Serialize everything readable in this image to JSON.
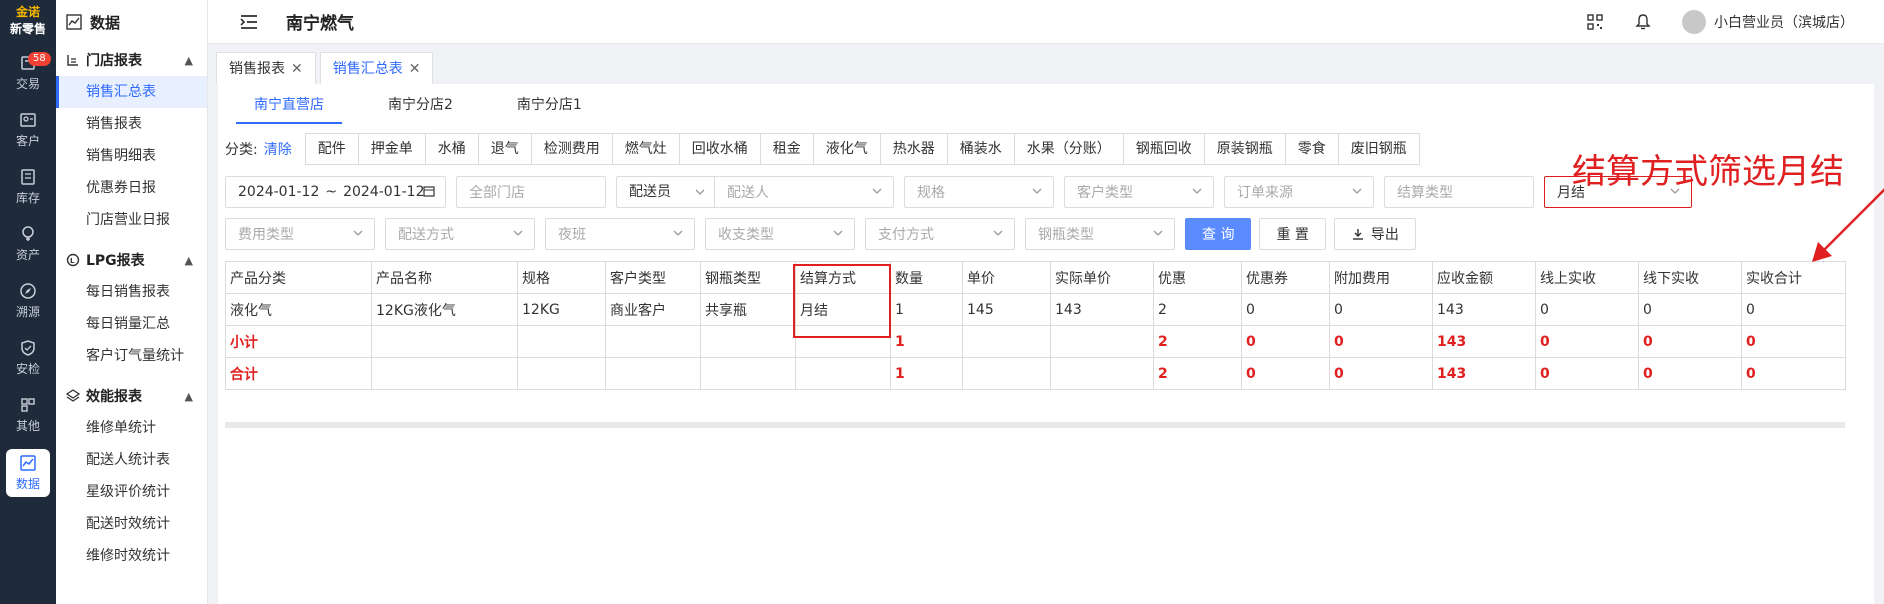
{
  "brand": {
    "logo_line1": "金诺",
    "logo_line2": "新零售"
  },
  "rail": [
    {
      "label": "交易",
      "icon": "trade-icon",
      "badge": "58"
    },
    {
      "label": "客户",
      "icon": "customer-icon"
    },
    {
      "label": "库存",
      "icon": "inventory-icon"
    },
    {
      "label": "资产",
      "icon": "asset-icon"
    },
    {
      "label": "溯源",
      "icon": "trace-icon"
    },
    {
      "label": "安检",
      "icon": "safety-icon"
    },
    {
      "label": "其他",
      "icon": "other-icon"
    },
    {
      "label": "数据",
      "icon": "data-icon",
      "active": true
    }
  ],
  "sidebar": {
    "header": "数据",
    "groups": [
      {
        "title": "门店报表",
        "items": [
          "销售汇总表",
          "销售报表",
          "销售明细表",
          "优惠券日报",
          "门店营业日报"
        ]
      },
      {
        "title": "LPG报表",
        "items": [
          "每日销售报表",
          "每日销量汇总",
          "客户订气量统计"
        ]
      },
      {
        "title": "效能报表",
        "items": [
          "维修单统计",
          "配送人统计表",
          "星级评价统计",
          "配送时效统计",
          "维修时效统计"
        ]
      }
    ]
  },
  "topbar": {
    "title": "南宁燃气",
    "user": "小白营业员（滨城店）"
  },
  "tabs": [
    {
      "label": "销售报表"
    },
    {
      "label": "销售汇总表",
      "active": true
    }
  ],
  "stores": [
    "南宁直营店",
    "南宁分店2",
    "南宁分店1"
  ],
  "categories": {
    "label": "分类:",
    "clear": "清除",
    "items": [
      "配件",
      "押金单",
      "水桶",
      "退气",
      "检测费用",
      "燃气灶",
      "回收水桶",
      "租金",
      "液化气",
      "热水器",
      "桶装水",
      "水果（分账）",
      "钢瓶回收",
      "原装钢瓶",
      "零食",
      "废旧钢瓶"
    ]
  },
  "filters": {
    "date_start": "2024-01-12",
    "date_sep": "~",
    "date_end": "2024-01-12",
    "all_stores": "全部门店",
    "courier_select": "配送员",
    "courier_placeholder": "配送人",
    "spec": "规格",
    "customer_type": "客户类型",
    "order_source": "订单来源",
    "settle_type": "结算类型",
    "settle_value": "月结",
    "fee_type": "费用类型",
    "delivery_method": "配送方式",
    "night_shift": "夜班",
    "income_type": "收支类型",
    "payment_method": "支付方式",
    "cylinder_type": "钢瓶类型",
    "query": "查 询",
    "reset": "重 置",
    "export": "导出"
  },
  "table": {
    "columns": [
      "产品分类",
      "产品名称",
      "规格",
      "客户类型",
      "钢瓶类型",
      "结算方式",
      "数量",
      "单价",
      "实际单价",
      "优惠",
      "优惠券",
      "附加费用",
      "应收金额",
      "线上实收",
      "线下实收",
      "实收合计"
    ],
    "rows": [
      [
        "液化气",
        "12KG液化气",
        "12KG",
        "商业客户",
        "共享瓶",
        "月结",
        "1",
        "145",
        "143",
        "2",
        "0",
        "0",
        "143",
        "0",
        "0",
        "0"
      ],
      [
        "小计",
        "",
        "",
        "",
        "",
        "",
        "1",
        "",
        "",
        "2",
        "0",
        "0",
        "143",
        "0",
        "0",
        "0"
      ],
      [
        "合计",
        "",
        "",
        "",
        "",
        "",
        "1",
        "",
        "",
        "2",
        "0",
        "0",
        "143",
        "0",
        "0",
        "0"
      ]
    ]
  },
  "annotation": "结算方式筛选月结",
  "colors": {
    "accent": "#2f6bff",
    "highlight": "#e02020",
    "rail_bg": "#1f2a3a"
  }
}
